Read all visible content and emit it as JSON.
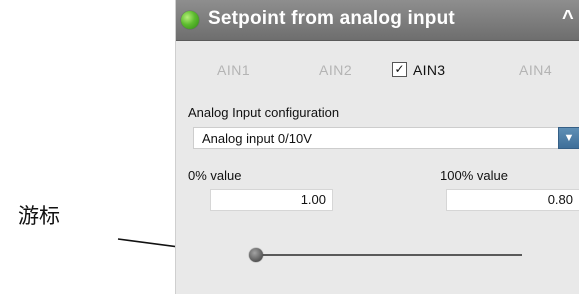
{
  "annotation": {
    "label": "游标"
  },
  "panel": {
    "title": "Setpoint from analog input",
    "collapse_icon": "^"
  },
  "tabs": [
    {
      "label": "AIN1",
      "active": false
    },
    {
      "label": "AIN2",
      "active": false
    },
    {
      "label": "AIN3",
      "active": true,
      "checked": true
    },
    {
      "label": "AIN4",
      "active": false
    }
  ],
  "checkbox_mark": "✓",
  "config": {
    "label": "Analog Input configuration",
    "selected": "Analog input 0/10V",
    "dropdown_icon": "chevron-down-icon"
  },
  "values": {
    "zero_label": "0% value",
    "zero_value": "1.00",
    "hundred_label": "100% value",
    "hundred_value": "0.80"
  },
  "slider": {
    "position": 0.0
  },
  "colors": {
    "header": "#7a7a7a",
    "status": "#4caf2a",
    "dropdown": "#4a7aa5"
  }
}
